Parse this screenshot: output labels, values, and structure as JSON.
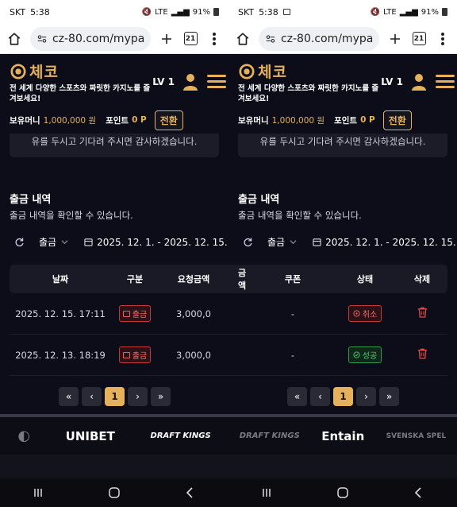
{
  "left": {
    "status": {
      "carrier": "SKT",
      "time": "5:38",
      "battery": "91%",
      "net": "LTE"
    },
    "browser": {
      "url": "cz-80.com/mypa",
      "tab_count": "21"
    },
    "header": {
      "brand": "체코",
      "tagline": "전 세계 다양한 스포츠와 짜릿한 카지노를 즐겨보세요!",
      "level": "LV 1"
    },
    "money": {
      "label": "보유머니",
      "value": "1,000,000 원",
      "points_label": "포인트",
      "points_value": "0 P",
      "convert": "전환"
    },
    "notice": "유를 두시고 기다려 주시면 감사하겠습니다.",
    "section": {
      "title": "출금 내역",
      "subtitle": "출금 내역을 확인할 수 있습니다."
    },
    "filter": {
      "type": "출금",
      "range": "2025. 12. 1. - 2025. 12. 15."
    },
    "table": {
      "headers": [
        "날짜",
        "구분",
        "요청금액"
      ],
      "rows": [
        {
          "date": "2025. 12. 15. 17:11",
          "type": "출금",
          "amount": "3,000,0"
        },
        {
          "date": "2025. 12. 13. 18:19",
          "type": "출금",
          "amount": "3,000,0"
        }
      ]
    },
    "pager": {
      "first": "«",
      "prev": "‹",
      "current": "1",
      "next": "›",
      "last": "»"
    },
    "brands": [
      "UNIBET",
      "DRAFT KINGS"
    ]
  },
  "right": {
    "status": {
      "carrier": "SKT",
      "time": "5:38",
      "battery": "91%",
      "net": "LTE"
    },
    "browser": {
      "url": "cz-80.com/mypa",
      "tab_count": "21"
    },
    "header": {
      "brand": "체코",
      "tagline": "전 세계 다양한 스포츠와 짜릿한 카지노를 즐겨보세요!",
      "level": "LV 1"
    },
    "money": {
      "label": "보유머니",
      "value": "1,000,000 원",
      "points_label": "포인트",
      "points_value": "0 P",
      "convert": "전환"
    },
    "notice": "유를 두시고 기다려 주시면 감사하겠습니다.",
    "section": {
      "title": "출금 내역",
      "subtitle": "출금 내역을 확인할 수 있습니다."
    },
    "filter": {
      "type": "출금",
      "range": "2025. 12. 1. - 2025. 12. 15."
    },
    "table": {
      "headers": [
        "금액",
        "쿠폰",
        "상태",
        "삭제"
      ],
      "rows": [
        {
          "coupon": "-",
          "status": "취소"
        },
        {
          "coupon": "-",
          "status": "성공"
        }
      ]
    },
    "pager": {
      "first": "«",
      "prev": "‹",
      "current": "1",
      "next": "›",
      "last": "»"
    },
    "brands": [
      "DRAFT KINGS",
      "Entain",
      "SVENSKA SPEL"
    ]
  },
  "colors": {
    "accent": "#e6b15c",
    "danger": "#ff6b6b",
    "success": "#4ccf72",
    "bg": "#0d0d1a"
  }
}
